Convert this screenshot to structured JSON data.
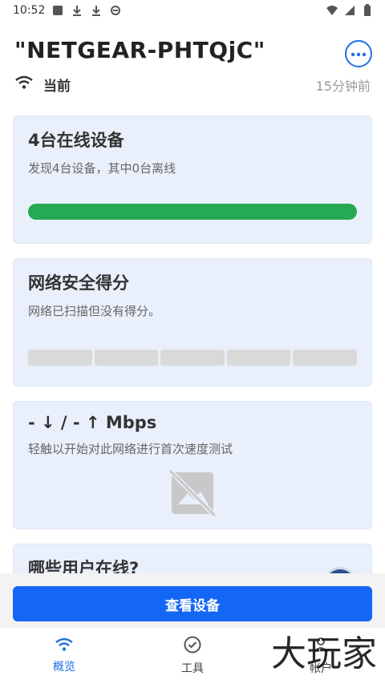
{
  "status_bar": {
    "time": "10:52",
    "icons": [
      "square-icon",
      "download-icon",
      "download-icon",
      "app-icon"
    ],
    "right_icons": [
      "wifi-icon",
      "signal-icon",
      "battery-icon"
    ]
  },
  "header": {
    "network_name": "\"NETGEAR-PHTQjC\"",
    "connection_label": "当前",
    "time_ago": "15分钟前",
    "more_icon": "more-icon"
  },
  "cards": {
    "devices": {
      "title": "4台在线设备",
      "subtitle": "发现4台设备，其中0台离线",
      "online_fraction": 1.0,
      "bar_color": "#25a954"
    },
    "security": {
      "title": "网络安全得分",
      "subtitle": "网络已扫描但没有得分。",
      "segments": 5
    },
    "speed": {
      "title": "- ↓ / - ↑ Mbps",
      "subtitle": "轻触以开始对此网络进行首次速度测试"
    },
    "online_users": {
      "title": "哪些用户在线?"
    }
  },
  "cta": {
    "label": "查看设备"
  },
  "tabs": [
    {
      "label": "概览",
      "icon": "wifi-icon",
      "active": true
    },
    {
      "label": "工具",
      "icon": "check-circle-icon",
      "active": false
    },
    {
      "label": "帐户",
      "icon": "user-icon",
      "active": false
    }
  ],
  "watermark": "大玩家",
  "colors": {
    "accent": "#1467f5",
    "card_bg": "#e9f0fb",
    "success": "#25a954"
  }
}
